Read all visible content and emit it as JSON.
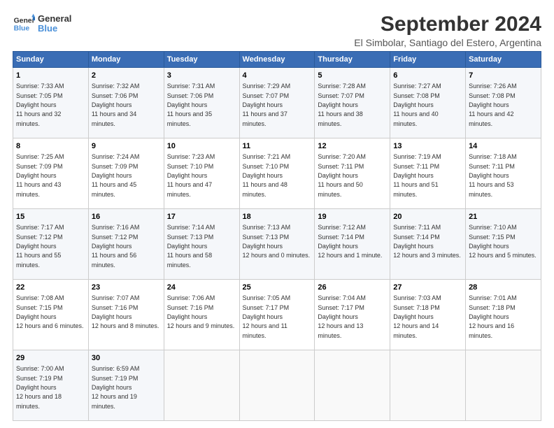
{
  "logo": {
    "line1": "General",
    "line2": "Blue"
  },
  "title": "September 2024",
  "subtitle": "El Simbolar, Santiago del Estero, Argentina",
  "days_of_week": [
    "Sunday",
    "Monday",
    "Tuesday",
    "Wednesday",
    "Thursday",
    "Friday",
    "Saturday"
  ],
  "weeks": [
    [
      {
        "day": "1",
        "sunrise": "7:33 AM",
        "sunset": "7:05 PM",
        "daylight": "11 hours and 32 minutes."
      },
      {
        "day": "2",
        "sunrise": "7:32 AM",
        "sunset": "7:06 PM",
        "daylight": "11 hours and 34 minutes."
      },
      {
        "day": "3",
        "sunrise": "7:31 AM",
        "sunset": "7:06 PM",
        "daylight": "11 hours and 35 minutes."
      },
      {
        "day": "4",
        "sunrise": "7:29 AM",
        "sunset": "7:07 PM",
        "daylight": "11 hours and 37 minutes."
      },
      {
        "day": "5",
        "sunrise": "7:28 AM",
        "sunset": "7:07 PM",
        "daylight": "11 hours and 38 minutes."
      },
      {
        "day": "6",
        "sunrise": "7:27 AM",
        "sunset": "7:08 PM",
        "daylight": "11 hours and 40 minutes."
      },
      {
        "day": "7",
        "sunrise": "7:26 AM",
        "sunset": "7:08 PM",
        "daylight": "11 hours and 42 minutes."
      }
    ],
    [
      {
        "day": "8",
        "sunrise": "7:25 AM",
        "sunset": "7:09 PM",
        "daylight": "11 hours and 43 minutes."
      },
      {
        "day": "9",
        "sunrise": "7:24 AM",
        "sunset": "7:09 PM",
        "daylight": "11 hours and 45 minutes."
      },
      {
        "day": "10",
        "sunrise": "7:23 AM",
        "sunset": "7:10 PM",
        "daylight": "11 hours and 47 minutes."
      },
      {
        "day": "11",
        "sunrise": "7:21 AM",
        "sunset": "7:10 PM",
        "daylight": "11 hours and 48 minutes."
      },
      {
        "day": "12",
        "sunrise": "7:20 AM",
        "sunset": "7:11 PM",
        "daylight": "11 hours and 50 minutes."
      },
      {
        "day": "13",
        "sunrise": "7:19 AM",
        "sunset": "7:11 PM",
        "daylight": "11 hours and 51 minutes."
      },
      {
        "day": "14",
        "sunrise": "7:18 AM",
        "sunset": "7:11 PM",
        "daylight": "11 hours and 53 minutes."
      }
    ],
    [
      {
        "day": "15",
        "sunrise": "7:17 AM",
        "sunset": "7:12 PM",
        "daylight": "11 hours and 55 minutes."
      },
      {
        "day": "16",
        "sunrise": "7:16 AM",
        "sunset": "7:12 PM",
        "daylight": "11 hours and 56 minutes."
      },
      {
        "day": "17",
        "sunrise": "7:14 AM",
        "sunset": "7:13 PM",
        "daylight": "11 hours and 58 minutes."
      },
      {
        "day": "18",
        "sunrise": "7:13 AM",
        "sunset": "7:13 PM",
        "daylight": "12 hours and 0 minutes."
      },
      {
        "day": "19",
        "sunrise": "7:12 AM",
        "sunset": "7:14 PM",
        "daylight": "12 hours and 1 minute."
      },
      {
        "day": "20",
        "sunrise": "7:11 AM",
        "sunset": "7:14 PM",
        "daylight": "12 hours and 3 minutes."
      },
      {
        "day": "21",
        "sunrise": "7:10 AM",
        "sunset": "7:15 PM",
        "daylight": "12 hours and 5 minutes."
      }
    ],
    [
      {
        "day": "22",
        "sunrise": "7:08 AM",
        "sunset": "7:15 PM",
        "daylight": "12 hours and 6 minutes."
      },
      {
        "day": "23",
        "sunrise": "7:07 AM",
        "sunset": "7:16 PM",
        "daylight": "12 hours and 8 minutes."
      },
      {
        "day": "24",
        "sunrise": "7:06 AM",
        "sunset": "7:16 PM",
        "daylight": "12 hours and 9 minutes."
      },
      {
        "day": "25",
        "sunrise": "7:05 AM",
        "sunset": "7:17 PM",
        "daylight": "12 hours and 11 minutes."
      },
      {
        "day": "26",
        "sunrise": "7:04 AM",
        "sunset": "7:17 PM",
        "daylight": "12 hours and 13 minutes."
      },
      {
        "day": "27",
        "sunrise": "7:03 AM",
        "sunset": "7:18 PM",
        "daylight": "12 hours and 14 minutes."
      },
      {
        "day": "28",
        "sunrise": "7:01 AM",
        "sunset": "7:18 PM",
        "daylight": "12 hours and 16 minutes."
      }
    ],
    [
      {
        "day": "29",
        "sunrise": "7:00 AM",
        "sunset": "7:19 PM",
        "daylight": "12 hours and 18 minutes."
      },
      {
        "day": "30",
        "sunrise": "6:59 AM",
        "sunset": "7:19 PM",
        "daylight": "12 hours and 19 minutes."
      },
      null,
      null,
      null,
      null,
      null
    ]
  ]
}
